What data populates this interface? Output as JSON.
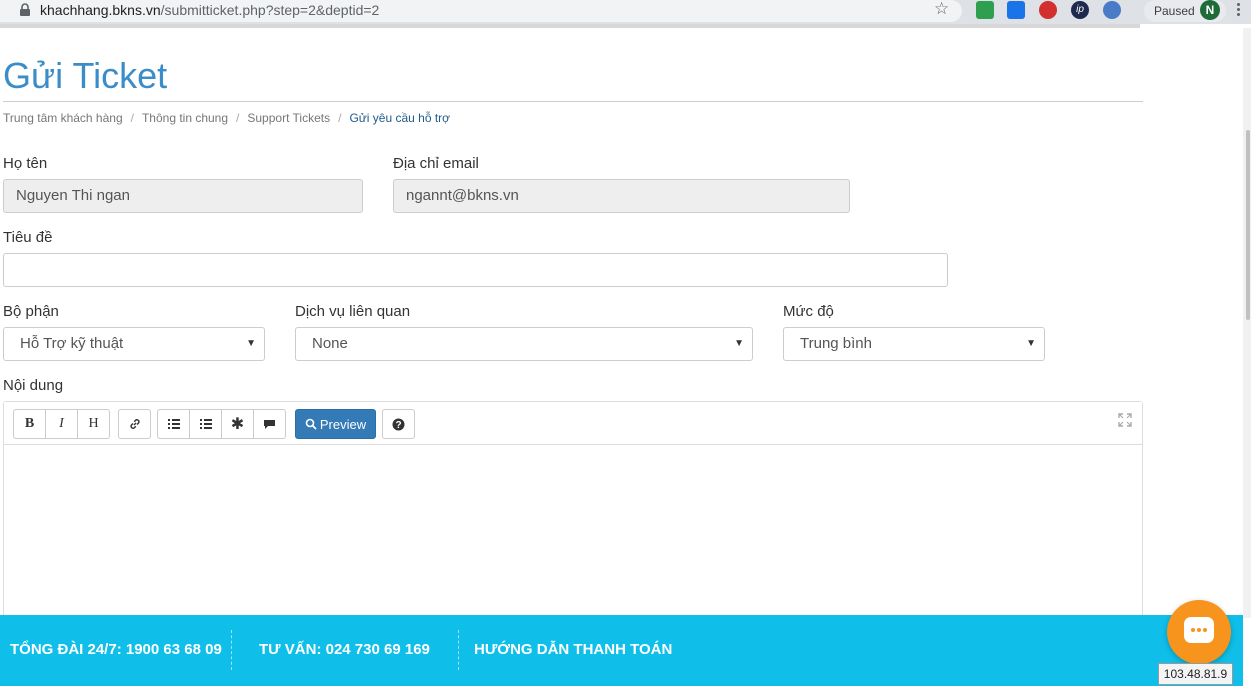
{
  "browser": {
    "url_host": "khachhang.bkns.vn",
    "url_path": "/submitticket.php?step=2&deptid=2",
    "profile_status": "Paused",
    "profile_initial": "N"
  },
  "page": {
    "title": "Gửi Ticket",
    "breadcrumb": [
      "Trung tâm khách hàng",
      "Thông tin chung",
      "Support Tickets",
      "Gửi yêu cầu hỗ trợ"
    ]
  },
  "form": {
    "name_label": "Họ tên",
    "name_value": "Nguyen Thi ngan",
    "email_label": "Địa chỉ email",
    "email_value": "ngannt@bkns.vn",
    "subject_label": "Tiêu đề",
    "subject_value": "",
    "department_label": "Bộ phận",
    "department_value": "Hỗ Trợ kỹ thuật",
    "service_label": "Dịch vụ liên quan",
    "service_value": "None",
    "priority_label": "Mức độ",
    "priority_value": "Trung bình",
    "content_label": "Nội dung"
  },
  "editor": {
    "preview_label": "Preview"
  },
  "footer": {
    "hotline": "TỔNG ĐÀI 24/7: 1900 63 68 09",
    "consult": "TƯ VẤN: 024 730 69 169",
    "payment": "HƯỚNG DẪN THANH TOÁN",
    "ip": "103.48.81.9"
  },
  "colors": {
    "title": "#3a8dc8",
    "footer_bg": "#0fbfea",
    "chat": "#f7941d",
    "preview_btn": "#337ab7"
  }
}
